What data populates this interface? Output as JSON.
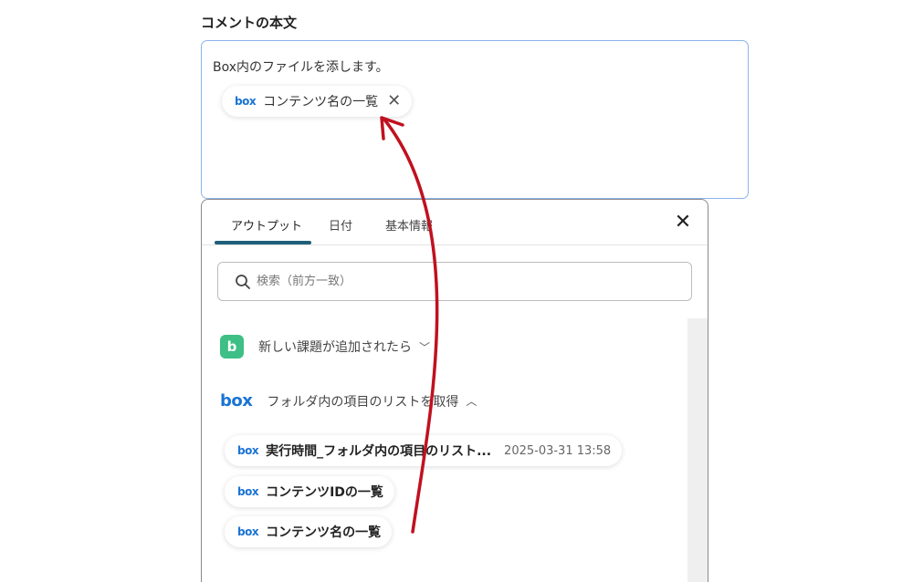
{
  "field_label": "コメントの本文",
  "comment": {
    "text": "Box内のファイルを添します。",
    "inline_chip": {
      "label": "コンテンツ名の一覧",
      "logo": "box"
    }
  },
  "popup": {
    "tabs": [
      {
        "label": "アウトプット"
      },
      {
        "label": "日付"
      },
      {
        "label": "基本情報"
      }
    ],
    "active_tab": "アウトプット",
    "search": {
      "placeholder": "検索（前方一致）",
      "value": ""
    },
    "groups": [
      {
        "label": "新しい課題が追加されたら",
        "icon": "b",
        "expanded": false
      },
      {
        "label": "フォルダ内の項目のリストを取得",
        "icon": "box",
        "expanded": true
      }
    ],
    "outputs": [
      {
        "label": "実行時間_フォルダ内の項目のリスト...",
        "value": "2025-03-31 13:58"
      },
      {
        "label": "コンテンツIDの一覧"
      },
      {
        "label": "コンテンツ名の一覧"
      }
    ]
  },
  "colors": {
    "accent_underline": "#1f5f79",
    "box_blue": "#1a73d4",
    "backlog_green": "#3dbf86",
    "arrow_red": "#c0111f"
  }
}
